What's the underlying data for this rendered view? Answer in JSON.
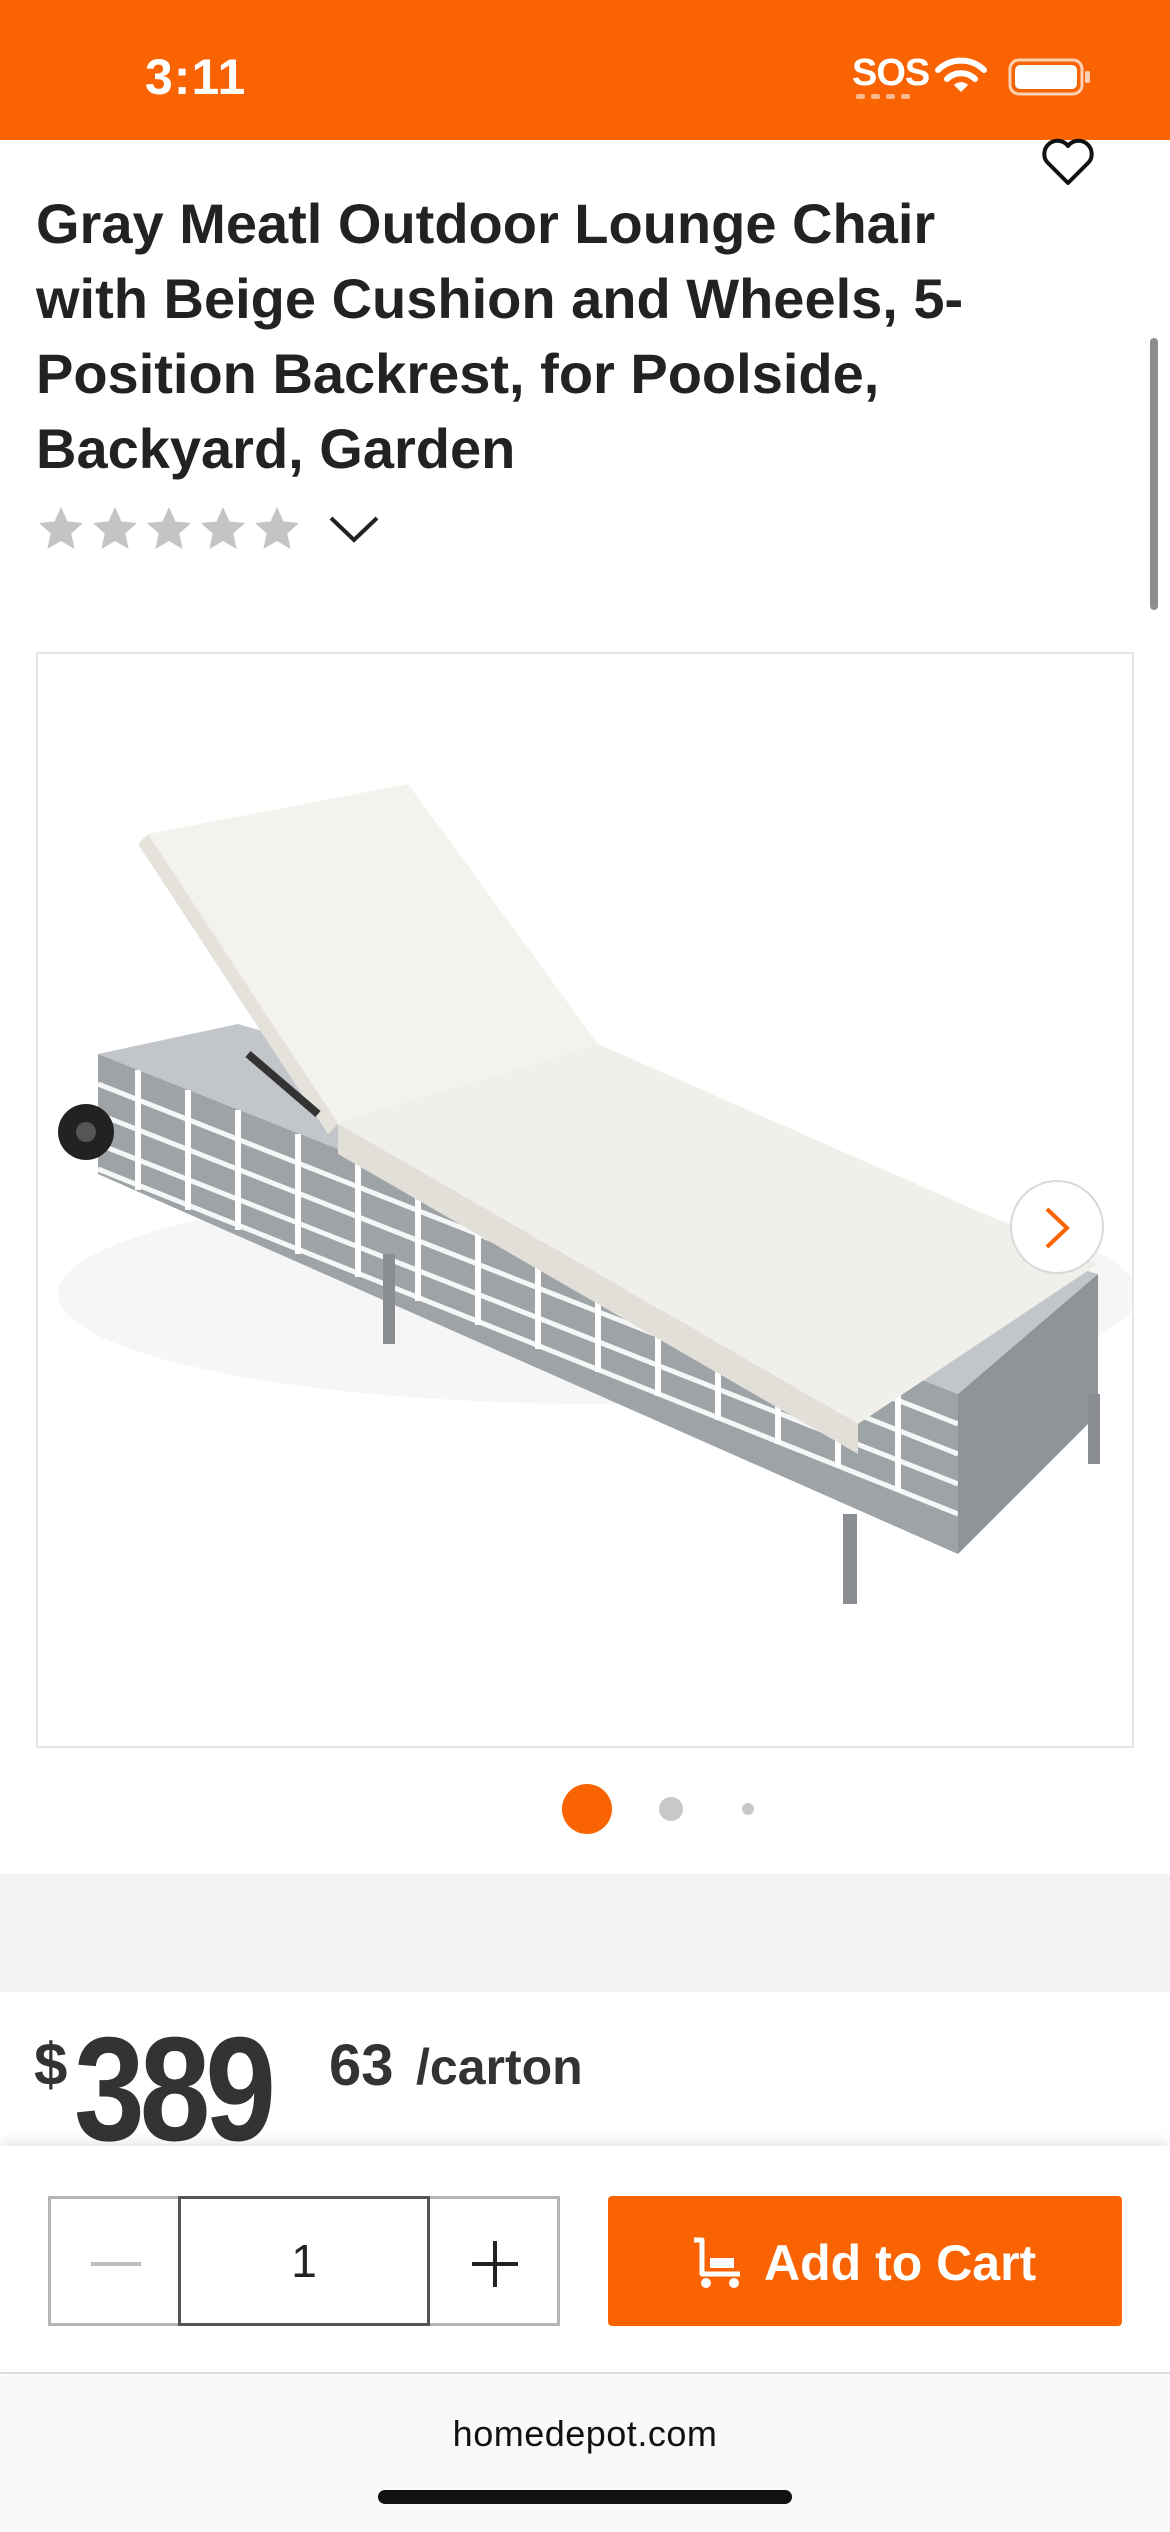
{
  "status_bar": {
    "time": "3:11",
    "sos": "SOS",
    "background_color": "#f96302"
  },
  "product": {
    "title": "Gray Meatl Outdoor Lounge Chair with Beige Cushion and Wheels, 5-Position Backrest, for Poolside, Backyard, Garden",
    "rating_stars": 0,
    "rating_max": 5,
    "image_count": 3,
    "active_image": 1
  },
  "price": {
    "currency": "$",
    "dollars": "389",
    "cents": "63",
    "unit": "/carton"
  },
  "cart": {
    "quantity": "1",
    "add_to_cart_label": "Add to Cart",
    "accent_color": "#f96302"
  },
  "browser": {
    "url": "homedepot.com"
  },
  "icons": [
    "wifi-icon",
    "battery-icon",
    "heart-icon",
    "star-icon",
    "chevron-down-icon",
    "chevron-right-icon",
    "minus-icon",
    "plus-icon",
    "cart-icon"
  ]
}
